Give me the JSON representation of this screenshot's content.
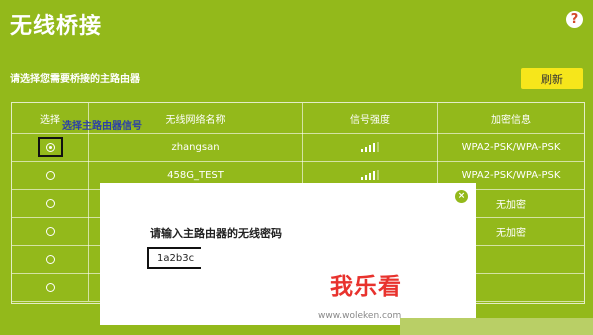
{
  "header": {
    "title": "无线桥接",
    "help_icon": "?"
  },
  "prompt": "请选择您需要桥接的主路由器",
  "refresh_label": "刷新",
  "table": {
    "headers": [
      "选择",
      "无线网络名称",
      "信号强度",
      "加密信息"
    ],
    "rows": [
      {
        "selected": true,
        "ssid": "zhangsan",
        "signal": 4,
        "security": "WPA2-PSK/WPA-PSK"
      },
      {
        "selected": false,
        "ssid": "458G_TEST",
        "signal": 4,
        "security": "WPA2-PSK/WPA-PSK"
      },
      {
        "selected": false,
        "ssid": "",
        "signal": 0,
        "security": "无加密"
      },
      {
        "selected": false,
        "ssid": "",
        "signal": 0,
        "security": "无加密"
      },
      {
        "selected": false,
        "ssid": "",
        "signal": 0,
        "security": ""
      },
      {
        "selected": false,
        "ssid": "",
        "signal": 0,
        "security": ""
      }
    ]
  },
  "annotation": "选择主路由器信号",
  "dialog": {
    "close_icon": "×",
    "label": "请输入主路由器的无线密码",
    "password_value": "1a2b3c"
  },
  "watermark": {
    "text": "我乐看",
    "url": "www.woleken.com"
  },
  "colors": {
    "background": "#93b91b",
    "button": "#f6e61b",
    "annotation": "#2b3fa8",
    "watermark": "#e8322d"
  }
}
